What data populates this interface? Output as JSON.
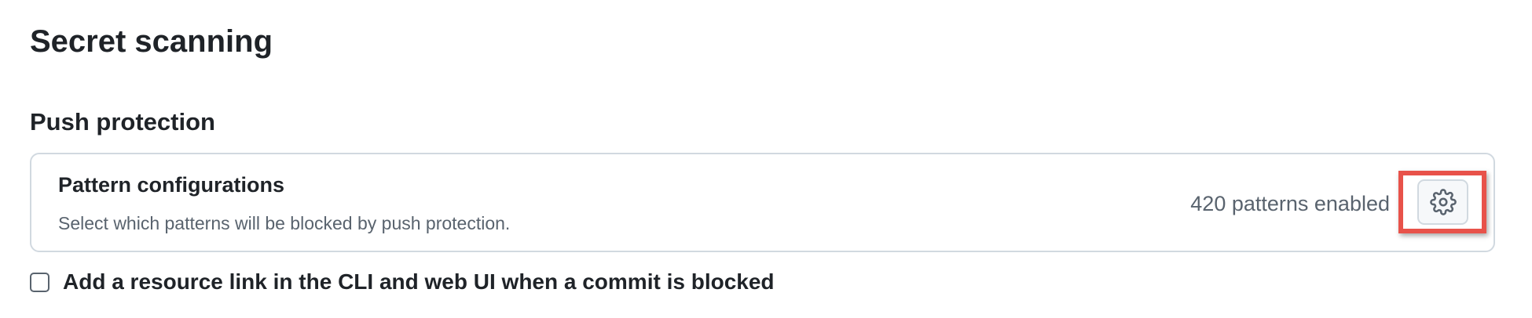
{
  "page": {
    "title": "Secret scanning"
  },
  "push_protection": {
    "heading": "Push protection",
    "pattern_config": {
      "title": "Pattern configurations",
      "description": "Select which patterns will be blocked by push protection.",
      "patterns_count_label": "420 patterns enabled",
      "settings_icon": "gear-icon",
      "highlight_color": "#e8524a"
    },
    "resource_link_checkbox": {
      "label": "Add a resource link in the CLI and web UI when a commit is blocked",
      "checked": false
    }
  }
}
